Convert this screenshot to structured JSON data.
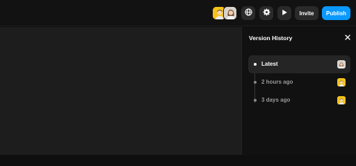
{
  "topbar": {
    "collaborators": [
      {
        "icon": "avatar-male-yellow",
        "color": "#f3c21b"
      },
      {
        "icon": "avatar-female-gray",
        "color": "#d9d3cc"
      }
    ],
    "icons": [
      "globe-icon",
      "gear-icon",
      "play-icon"
    ],
    "invite_label": "Invite",
    "publish_label": "Publish",
    "accent_color": "#0a99ff"
  },
  "version_panel": {
    "title": "Version History",
    "close_icon": "close-icon",
    "versions": [
      {
        "label": "Latest",
        "active": true,
        "avatar": "avatar-female-gray"
      },
      {
        "label": "2 hours ago",
        "active": false,
        "avatar": "avatar-male-yellow"
      },
      {
        "label": "3 days ago",
        "active": false,
        "avatar": "avatar-male-yellow"
      }
    ]
  }
}
